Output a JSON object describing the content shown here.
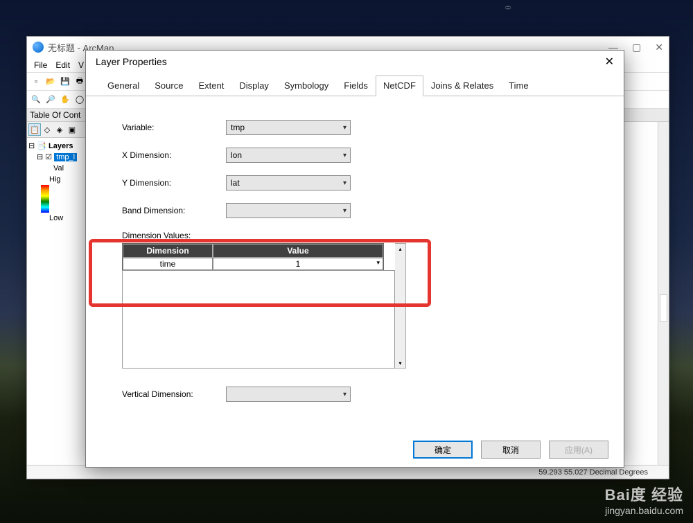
{
  "arcmap": {
    "title": "无标题 - ArcMap",
    "menu": [
      "File",
      "Edit",
      "V"
    ],
    "toc_title": "Table Of Cont",
    "layers_root": "Layers",
    "layer_name": "tmp_l",
    "val_label": "Val",
    "hig_label": "Hig",
    "low_label": "Low",
    "status_coords": "59.293  55.027 Decimal Degrees"
  },
  "dialog": {
    "title": "Layer Properties",
    "tabs": [
      "General",
      "Source",
      "Extent",
      "Display",
      "Symbology",
      "Fields",
      "NetCDF",
      "Joins & Relates",
      "Time"
    ],
    "active_tab": "NetCDF",
    "variable_label": "Variable:",
    "variable_value": "tmp",
    "xdim_label": "X Dimension:",
    "xdim_value": "lon",
    "ydim_label": "Y Dimension:",
    "ydim_value": "lat",
    "banddim_label": "Band Dimension:",
    "banddim_value": "",
    "dimvalues_label": "Dimension Values:",
    "dimtable_headers": [
      "Dimension",
      "Value"
    ],
    "dimtable_row": {
      "dimension": "time",
      "value": "1"
    },
    "vdim_label": "Vertical Dimension:",
    "vdim_value": "",
    "ok_btn": "确定",
    "cancel_btn": "取消",
    "apply_btn": "应用(A)"
  },
  "watermark": {
    "brand": "Bai度 经验",
    "url": "jingyan.baidu.com"
  }
}
